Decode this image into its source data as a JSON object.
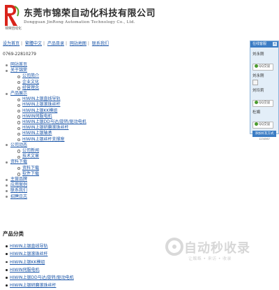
{
  "header": {
    "company_cn": "东莞市锦荣自动化科技有限公司",
    "company_en": "Dongguan JinRong Automation Technology Co., Ltd.",
    "logo_sub": "锦荣自动化",
    "logo_color": "#d9241b"
  },
  "topnav": {
    "items": [
      {
        "label": "设为首页"
      },
      {
        "label": "繁體中文"
      },
      {
        "label": "产品目录"
      },
      {
        "label": "网站地图"
      },
      {
        "label": "联系我们"
      }
    ]
  },
  "phone": "0769-22810279",
  "menu": {
    "home": "网站首页",
    "about": "关于锦荣",
    "about_children": [
      "公司简介",
      "企业文化",
      "经营理念"
    ],
    "products": "产品展示",
    "products_children": [
      "HIWIN上银直线导轨",
      "HIWIN上银滚珠丝杆",
      "HIWIN上银KK模组",
      "HIWIN伺服电机",
      "HIWIN上银DD马达/旋转/驱动电机",
      "HIWIN上银研磨滚珠丝杆",
      "HIWIN上银轴承",
      "HIWIN上银丝杆支撑座"
    ],
    "news": "公司动态",
    "news_children": [
      "公司新闻",
      "技术文章"
    ],
    "downloads": "资料下载",
    "downloads_children": [
      "资料下载",
      "软件下载"
    ],
    "extra": [
      "主营品牌",
      "应用案例",
      "联系我们",
      "招聘日志"
    ]
  },
  "category_section": {
    "title": "产品分类",
    "items": [
      "HIWIN上银直线导轨",
      "HIWIN上银滚珠丝杆",
      "HIWIN上银KK模组",
      "HIWIN伺服电机",
      "HIWIN上银DD马达/旋转/驱动电机",
      "HIWIN上银研磨滚珠丝杆"
    ]
  },
  "qq_panel": {
    "header": "在线客服",
    "contacts": [
      {
        "name": "刘永刚",
        "button": "QQ交谈"
      },
      {
        "name": "刘永刚",
        "button": "QQ交谈"
      },
      {
        "name": "刘玲莉",
        "button": "QQ交谈"
      },
      {
        "name": "杜娟",
        "button": "QQ交谈"
      }
    ],
    "footer": "添加好友方式",
    "footer_sub": "1234567"
  },
  "watermark": {
    "text": "自动秒收录",
    "sub": "让蜘蛛 • 来访 • 收录"
  }
}
